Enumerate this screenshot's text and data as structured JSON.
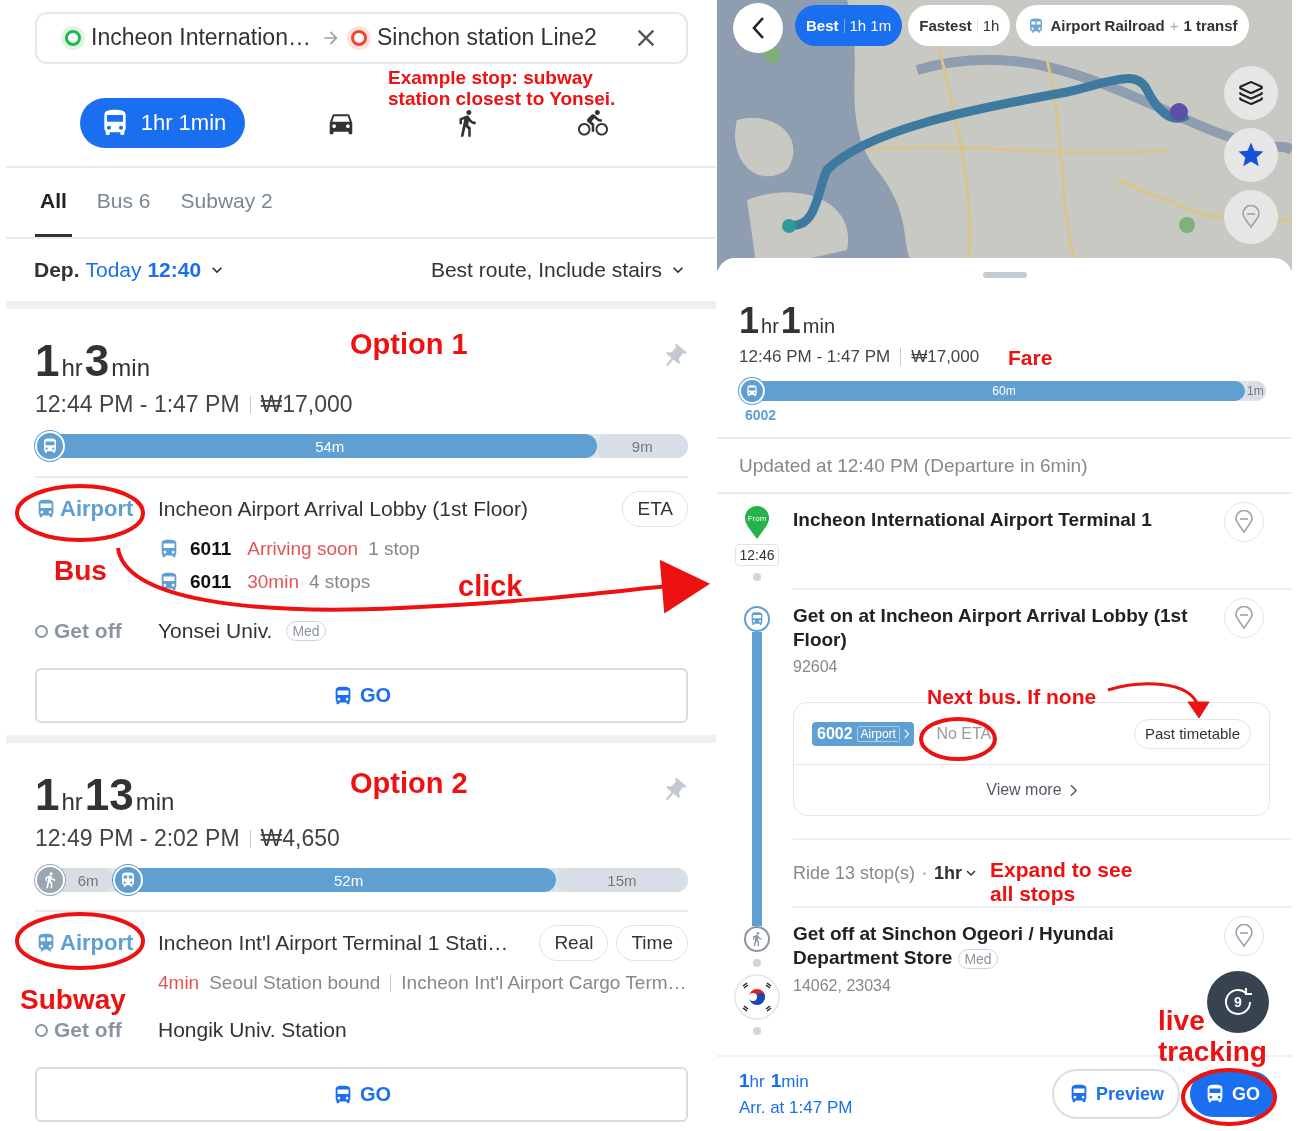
{
  "left": {
    "origin": "Incheon Internation…",
    "destination": "Sinchon station Line2",
    "modes": [
      {
        "kind": "bus",
        "label": "1hr 1min",
        "selected": true
      },
      {
        "kind": "car",
        "selected": false
      },
      {
        "kind": "walk",
        "selected": false
      },
      {
        "kind": "bike",
        "selected": false
      }
    ],
    "tabs": [
      {
        "label": "All",
        "selected": true
      },
      {
        "label": "Bus 6",
        "selected": false
      },
      {
        "label": "Subway 2",
        "selected": false
      }
    ],
    "departure": {
      "label": "Dep.",
      "day": "Today",
      "time": "12:40"
    },
    "sort": "Best route, Include stairs",
    "options": [
      {
        "duration": {
          "hours": "1",
          "hours_unit": "hr",
          "minutes": "3",
          "minutes_unit": "min"
        },
        "times": "12:44 PM - 1:47 PM",
        "fare": "₩17,000",
        "segments": [
          {
            "kind": "bus",
            "label": "54m",
            "level": 0.86
          },
          {
            "kind": "rest",
            "label": "9m",
            "level": 0.14
          }
        ],
        "leg": {
          "kind": "bus",
          "line": "Airport",
          "stop": "Incheon Airport Arrival Lobby (1st Floor)",
          "chips": [
            "ETA"
          ],
          "arrivals": [
            {
              "route": "6011",
              "eta": "Arriving soon",
              "stops": "1 stop"
            },
            {
              "route": "6011",
              "eta": "30min",
              "stops": "4 stops"
            }
          ]
        },
        "get_off": {
          "label": "Get off",
          "stop": "Yonsei Univ.",
          "badge": "Med"
        },
        "go": "GO"
      },
      {
        "duration": {
          "hours": "1",
          "hours_unit": "hr",
          "minutes": "13",
          "minutes_unit": "min"
        },
        "times": "12:49 PM - 2:02 PM",
        "fare": "₩4,650",
        "segments": [
          {
            "kind": "walk",
            "label": "6m",
            "level": 0.12
          },
          {
            "kind": "subway",
            "label": "52m",
            "level": 0.77
          },
          {
            "kind": "rest",
            "label": "15m",
            "level": 0.23
          }
        ],
        "leg": {
          "kind": "subway",
          "line": "Airport",
          "stop": "Incheon Int'l Airport Terminal 1 Stati…",
          "chips": [
            "Real",
            "Time"
          ],
          "info": {
            "eta": "4min",
            "direction": "Seoul Station bound",
            "next": "Incheon Int'l Airport Cargo Term…"
          }
        },
        "get_off": {
          "label": "Get off",
          "stop": "Hongik Univ. Station"
        },
        "go": "GO"
      }
    ]
  },
  "right": {
    "route_chips": [
      {
        "kind": "time",
        "label": "Best",
        "value": "1h 1m",
        "selected": true
      },
      {
        "kind": "time",
        "label": "Fastest",
        "value": "1h",
        "selected": false
      },
      {
        "kind": "rail",
        "label": "Airport Railroad",
        "plus": "+",
        "value": "1 transf",
        "selected": false
      }
    ],
    "summary": {
      "duration": {
        "hours": "1",
        "hours_unit": "hr",
        "minutes": "1",
        "minutes_unit": "min"
      },
      "times": "12:46 PM - 1:47 PM",
      "fare": "₩17,000",
      "segments": [
        {
          "kind": "bus",
          "label": "60m",
          "level": 0.96
        },
        {
          "kind": "rest",
          "label": "1m",
          "level": 0.04
        }
      ],
      "route": "6002"
    },
    "updated": "Updated at 12:40 PM (Departure in 6min)",
    "steps": [
      {
        "kind": "from",
        "pin": "From",
        "time": "12:46",
        "title": "Incheon International Airport Terminal 1"
      },
      {
        "kind": "board",
        "title": "Get on at Incheon Airport Arrival Lobby (1st Floor)",
        "code": "92604",
        "arrival": {
          "route": "6002",
          "direction": "Airport",
          "status": "No ETA",
          "timetable": "Past timetable",
          "more": "View more"
        }
      },
      {
        "kind": "ride",
        "text": "Ride 13 stop(s)",
        "duration": "1hr"
      },
      {
        "kind": "alight",
        "title": "Get off at Sinchon Ogeori / Hyundai Department Store",
        "badge": "Med",
        "code": "14062, 23034"
      }
    ],
    "replay": "9",
    "footer": {
      "duration": {
        "hours": "1",
        "hours_unit": "hr",
        "minutes": "1",
        "minutes_unit": "min"
      },
      "arrival": "Arr. at 1:47 PM",
      "preview": "Preview",
      "go": "GO"
    }
  },
  "annotations": [
    "Example stop: subway station closest to Yonsei.",
    "Option 1",
    "Bus",
    "click",
    "Option 2",
    "Subway",
    "Fare",
    "Next bus. If none",
    "Expand to see all stops",
    "live tracking"
  ]
}
